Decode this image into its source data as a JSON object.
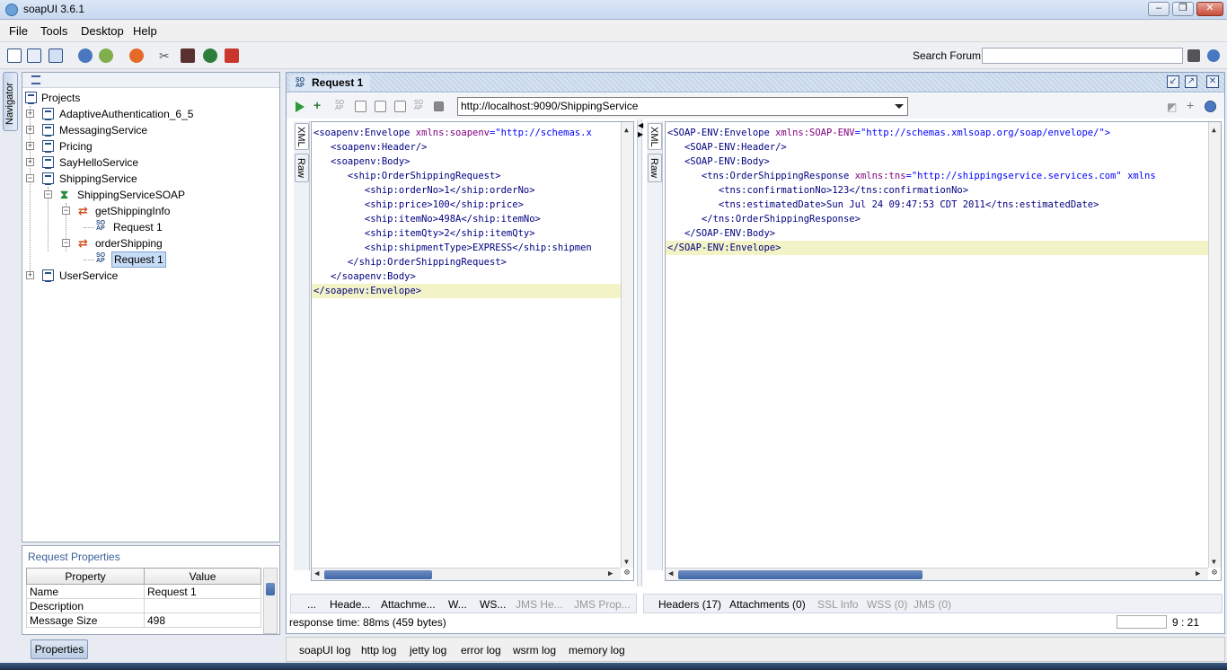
{
  "window": {
    "title": "soapUI 3.6.1"
  },
  "menu": [
    "File",
    "Tools",
    "Desktop",
    "Help"
  ],
  "toolbar": {
    "search_label": "Search Forum",
    "search_value": ""
  },
  "navigator": {
    "tab_label": "Navigator"
  },
  "tree": {
    "root": "Projects",
    "items": [
      "AdaptiveAuthentication_6_5",
      "MessagingService",
      "Pricing",
      "SayHelloService",
      "ShippingService",
      "ShippingServiceSOAP",
      "getShippingInfo",
      "Request 1",
      "orderShipping",
      "Request 1",
      "UserService"
    ]
  },
  "properties": {
    "title": "Request Properties",
    "headers": [
      "Property",
      "Value"
    ],
    "rows": [
      [
        "Name",
        "Request 1"
      ],
      [
        "Description",
        ""
      ],
      [
        "Message Size",
        "498"
      ]
    ],
    "button": "Properties"
  },
  "request": {
    "title": "Request 1",
    "endpoint": "http://localhost:9090/ShippingService",
    "side_tabs": [
      "XML",
      "Raw"
    ],
    "xml_lines": [
      [
        "<soapenv:Envelope ",
        "xmlns:soapenv",
        "=\"http://schemas.x"
      ],
      [
        "   <soapenv:Header/>",
        "",
        ""
      ],
      [
        "   <soapenv:Body>",
        "",
        ""
      ],
      [
        "      <ship:OrderShippingRequest>",
        "",
        ""
      ],
      [
        "         <ship:orderNo>1</ship:orderNo>",
        "",
        ""
      ],
      [
        "         <ship:price>100</ship:price>",
        "",
        ""
      ],
      [
        "         <ship:itemNo>498A</ship:itemNo>",
        "",
        ""
      ],
      [
        "         <ship:itemQty>2</ship:itemQty>",
        "",
        ""
      ],
      [
        "         <ship:shipmentType>EXPRESS</ship:shipmen",
        "",
        ""
      ],
      [
        "      </ship:OrderShippingRequest>",
        "",
        ""
      ],
      [
        "   </soapenv:Body>",
        "",
        ""
      ],
      [
        "</soapenv:Envelope>",
        "",
        ""
      ]
    ],
    "bottom_tabs": [
      "...",
      "Heade...",
      "Attachme...",
      "W...",
      "WS...",
      "JMS He...",
      "JMS Prop..."
    ]
  },
  "response": {
    "side_tabs": [
      "XML",
      "Raw"
    ],
    "xml_lines": [
      [
        "<SOAP-ENV:Envelope ",
        "xmlns:SOAP-ENV",
        "=\"http://schemas.xmlsoap.org/soap/envelope/\">"
      ],
      [
        "   <SOAP-ENV:Header/>",
        "",
        ""
      ],
      [
        "   <SOAP-ENV:Body>",
        "",
        ""
      ],
      [
        "      <tns:OrderShippingResponse ",
        "xmlns:tns",
        "=\"http://shippingservice.services.com\" xmlns"
      ],
      [
        "         <tns:confirmationNo>123</tns:confirmationNo>",
        "",
        ""
      ],
      [
        "         <tns:estimatedDate>Sun Jul 24 09:47:53 CDT 2011</tns:estimatedDate>",
        "",
        ""
      ],
      [
        "      </tns:OrderShippingResponse>",
        "",
        ""
      ],
      [
        "   </SOAP-ENV:Body>",
        "",
        ""
      ],
      [
        "</SOAP-ENV:Envelope>",
        "",
        ""
      ]
    ],
    "bottom_tabs": [
      "Headers (17)",
      "Attachments (0)",
      "SSL Info",
      "WSS (0)",
      "JMS (0)"
    ]
  },
  "status": {
    "response_time": "response time: 88ms (459 bytes)",
    "caret": "9 : 21"
  },
  "logs": [
    "soapUI log",
    "http log",
    "jetty log",
    "error log",
    "wsrm log",
    "memory log"
  ]
}
